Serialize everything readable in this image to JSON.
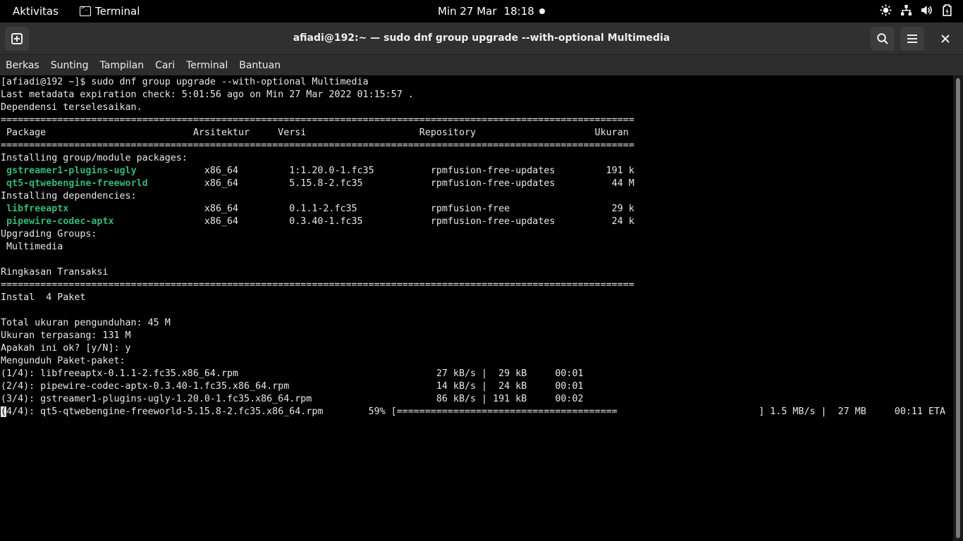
{
  "topbar": {
    "activities": "Aktivitas",
    "app_name": "Terminal",
    "date": "Min 27 Mar",
    "time": "18:18"
  },
  "window": {
    "title": "afiadi@192:~ — sudo dnf group upgrade --with-optional Multimedia"
  },
  "menu": {
    "items": [
      "Berkas",
      "Sunting",
      "Tampilan",
      "Cari",
      "Terminal",
      "Bantuan"
    ]
  },
  "terminal": {
    "lines": [
      "[afiadi@192 ~]$ sudo dnf group upgrade --with-optional Multimedia",
      "Last metadata expiration check: 5:01:56 ago on Min 27 Mar 2022 01:15:57 .",
      "Dependensi terselesaikan.",
      "================================================================================================================",
      " Package                          Arsitektur     Versi                    Repository                     Ukuran",
      "================================================================================================================",
      "Installing group/module packages:",
      "PKG",
      "PKG",
      "Installing dependencies:",
      "PKG",
      "PKG",
      "Upgrading Groups:",
      " Multimedia",
      "",
      "Ringkasan Transaksi",
      "================================================================================================================",
      "Instal  4 Paket",
      "",
      "Total ukuran pengunduhan: 45 M",
      "Ukuran terpasang: 131 M",
      "Apakah ini ok? [y/N]: y",
      "Mengunduh Paket-paket:",
      "(1/4): libfreeaptx-0.1.1-2.fc35.x86_64.rpm                                   27 kB/s |  29 kB     00:01",
      "(2/4): pipewire-codec-aptx-0.3.40-1.fc35.x86_64.rpm                          14 kB/s |  24 kB     00:01",
      "(3/4): gstreamer1-plugins-ugly-1.20.0-1.fc35.x86_64.rpm                      86 kB/s | 191 kB     00:02",
      "CURSOR"
    ],
    "packages": [
      {
        "name": "gstreamer1-plugins-ugly",
        "rest": "            x86_64         1:1.20.0-1.fc35          rpmfusion-free-updates         191 k"
      },
      {
        "name": "qt5-qtwebengine-freeworld",
        "rest": "          x86_64         5.15.8-2.fc35            rpmfusion-free-updates          44 M"
      },
      {
        "name": "libfreeaptx",
        "rest": "                        x86_64         0.1.1-2.fc35             rpmfusion-free                  29 k"
      },
      {
        "name": "pipewire-codec-aptx",
        "rest": "                x86_64         0.3.40-1.fc35            rpmfusion-free-updates          24 k"
      }
    ],
    "progress_line": {
      "cursor_char": "(",
      "text": "4/4): qt5-qtwebengine-freeworld-5.15.8-2.fc35.x86_64.rpm        59% [=======================================                         ] 1.5 MB/s |  27 MB     00:11 ETA"
    }
  }
}
